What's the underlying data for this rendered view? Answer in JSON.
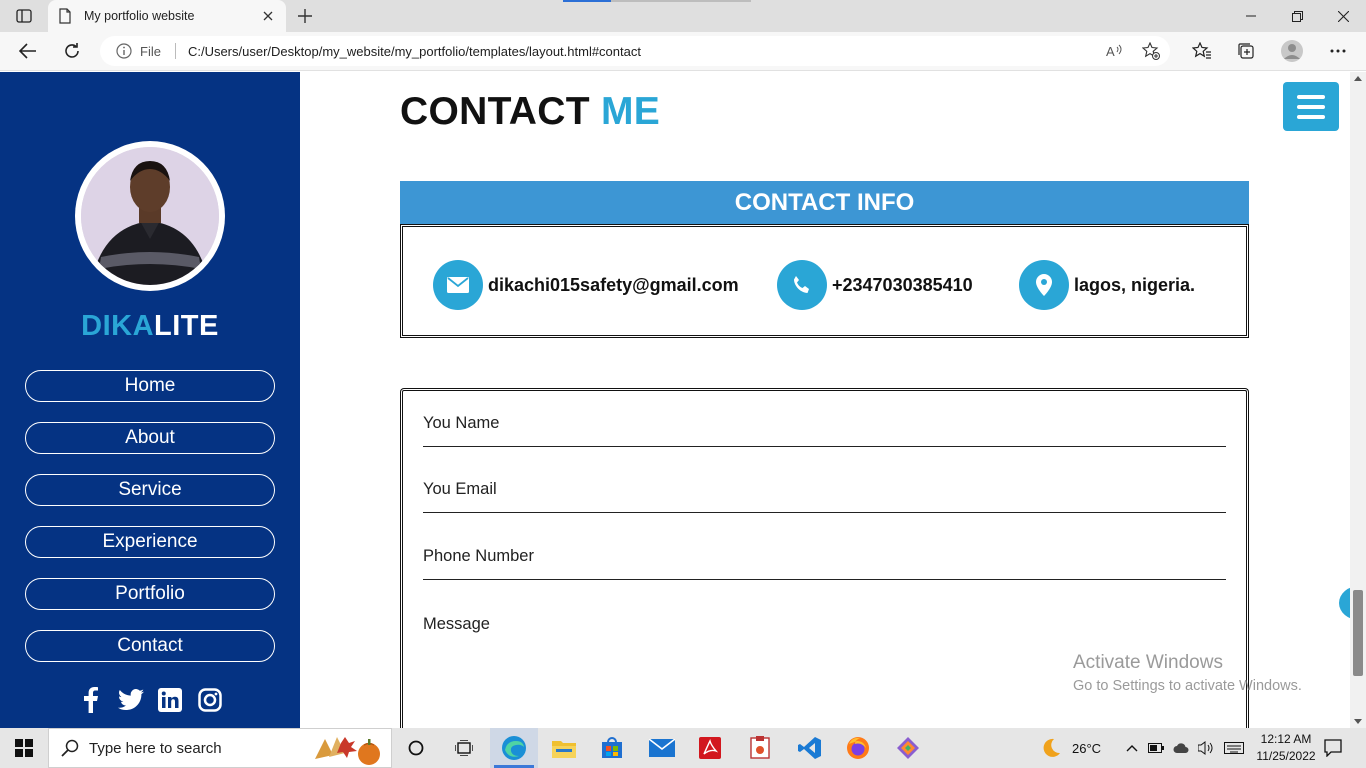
{
  "browser": {
    "tab_title": "My portfolio website",
    "url_scheme": "File",
    "url": "C:/Users/user/Desktop/my_website/my_portfolio/templates/layout.html#contact"
  },
  "sidebar": {
    "brand_part1": "DIKA",
    "brand_part2": "LITE",
    "nav": [
      {
        "label": "Home"
      },
      {
        "label": "About"
      },
      {
        "label": "Service"
      },
      {
        "label": "Experience"
      },
      {
        "label": "Portfolio"
      },
      {
        "label": "Contact"
      }
    ],
    "socials": [
      "facebook-icon",
      "twitter-icon",
      "linkedin-icon",
      "instagram-icon"
    ]
  },
  "main": {
    "title_part1": "CONTACT",
    "title_part2": "ME",
    "contact_info_header": "CONTACT INFO",
    "email": "dikachi015safety@gmail.com",
    "phone": "+2347030385410",
    "location": "lagos, nigeria.",
    "form": {
      "name_label": "You Name",
      "email_label": "You Email",
      "phone_label": "Phone Number",
      "message_label": "Message"
    }
  },
  "watermark": {
    "line1": "Activate Windows",
    "line2": "Go to Settings to activate Windows."
  },
  "taskbar": {
    "search_placeholder": "Type here to search",
    "temperature": "26°C",
    "time": "12:12 AM",
    "date": "11/25/2022"
  },
  "colors": {
    "sidebar_bg": "#053383",
    "accent": "#2aa6d6",
    "header_blue": "#3d96d4"
  }
}
